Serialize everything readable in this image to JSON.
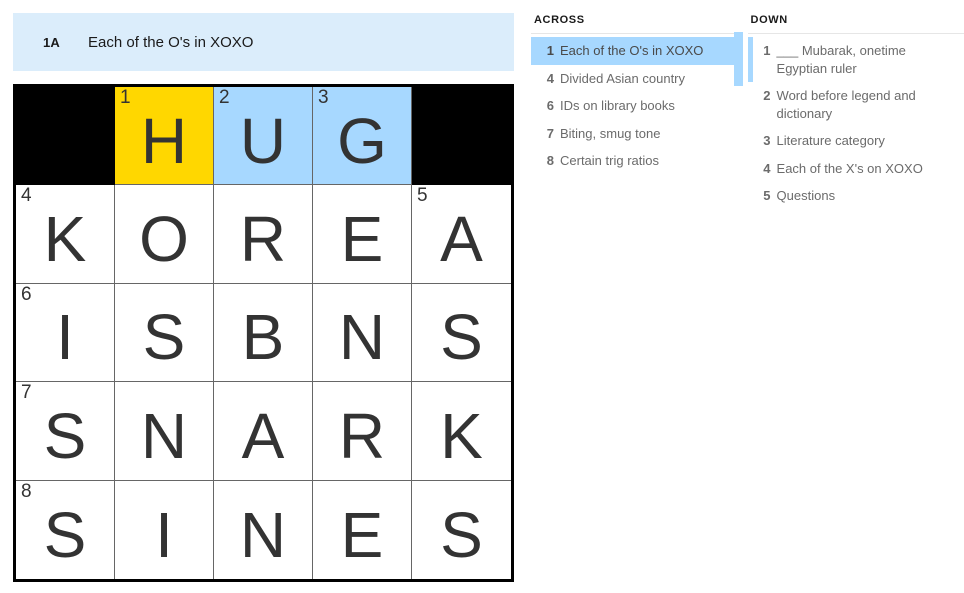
{
  "current_clue": {
    "number": "1A",
    "text": "Each of the O's in XOXO"
  },
  "colors": {
    "cursor_cell": "#ffd700",
    "active_word": "#a7d8ff",
    "clue_bar_bg": "#dbedfb",
    "block": "#000000",
    "letter": "#333333"
  },
  "grid": {
    "rows": 5,
    "cols": 5,
    "cells": [
      [
        {
          "type": "block"
        },
        {
          "type": "fill",
          "number": "1",
          "letter": "H",
          "highlight": "cursor"
        },
        {
          "type": "fill",
          "number": "2",
          "letter": "U",
          "highlight": "word"
        },
        {
          "type": "fill",
          "number": "3",
          "letter": "G",
          "highlight": "word"
        },
        {
          "type": "block"
        }
      ],
      [
        {
          "type": "fill",
          "number": "4",
          "letter": "K",
          "highlight": "none"
        },
        {
          "type": "fill",
          "number": "",
          "letter": "O",
          "highlight": "none"
        },
        {
          "type": "fill",
          "number": "",
          "letter": "R",
          "highlight": "none"
        },
        {
          "type": "fill",
          "number": "",
          "letter": "E",
          "highlight": "none"
        },
        {
          "type": "fill",
          "number": "5",
          "letter": "A",
          "highlight": "none"
        }
      ],
      [
        {
          "type": "fill",
          "number": "6",
          "letter": "I",
          "highlight": "none"
        },
        {
          "type": "fill",
          "number": "",
          "letter": "S",
          "highlight": "none"
        },
        {
          "type": "fill",
          "number": "",
          "letter": "B",
          "highlight": "none"
        },
        {
          "type": "fill",
          "number": "",
          "letter": "N",
          "highlight": "none"
        },
        {
          "type": "fill",
          "number": "",
          "letter": "S",
          "highlight": "none"
        }
      ],
      [
        {
          "type": "fill",
          "number": "7",
          "letter": "S",
          "highlight": "none"
        },
        {
          "type": "fill",
          "number": "",
          "letter": "N",
          "highlight": "none"
        },
        {
          "type": "fill",
          "number": "",
          "letter": "A",
          "highlight": "none"
        },
        {
          "type": "fill",
          "number": "",
          "letter": "R",
          "highlight": "none"
        },
        {
          "type": "fill",
          "number": "",
          "letter": "K",
          "highlight": "none"
        }
      ],
      [
        {
          "type": "fill",
          "number": "8",
          "letter": "S",
          "highlight": "none"
        },
        {
          "type": "fill",
          "number": "",
          "letter": "I",
          "highlight": "none"
        },
        {
          "type": "fill",
          "number": "",
          "letter": "N",
          "highlight": "none"
        },
        {
          "type": "fill",
          "number": "",
          "letter": "E",
          "highlight": "none"
        },
        {
          "type": "fill",
          "number": "",
          "letter": "S",
          "highlight": "none"
        }
      ]
    ]
  },
  "across": {
    "title": "ACROSS",
    "clues": [
      {
        "number": "1",
        "text": "Each of the O's in XOXO",
        "state": "selected"
      },
      {
        "number": "4",
        "text": "Divided Asian country",
        "state": "normal"
      },
      {
        "number": "6",
        "text": "IDs on library books",
        "state": "normal"
      },
      {
        "number": "7",
        "text": "Biting, smug tone",
        "state": "normal"
      },
      {
        "number": "8",
        "text": "Certain trig ratios",
        "state": "normal"
      }
    ]
  },
  "down": {
    "title": "DOWN",
    "clues": [
      {
        "number": "1",
        "text": "___ Mubarak, onetime Egyptian ruler",
        "state": "accent"
      },
      {
        "number": "2",
        "text": "Word before legend and dictionary",
        "state": "normal"
      },
      {
        "number": "3",
        "text": "Literature category",
        "state": "normal"
      },
      {
        "number": "4",
        "text": "Each of the X's on XOXO",
        "state": "normal"
      },
      {
        "number": "5",
        "text": "Questions",
        "state": "normal"
      }
    ]
  }
}
